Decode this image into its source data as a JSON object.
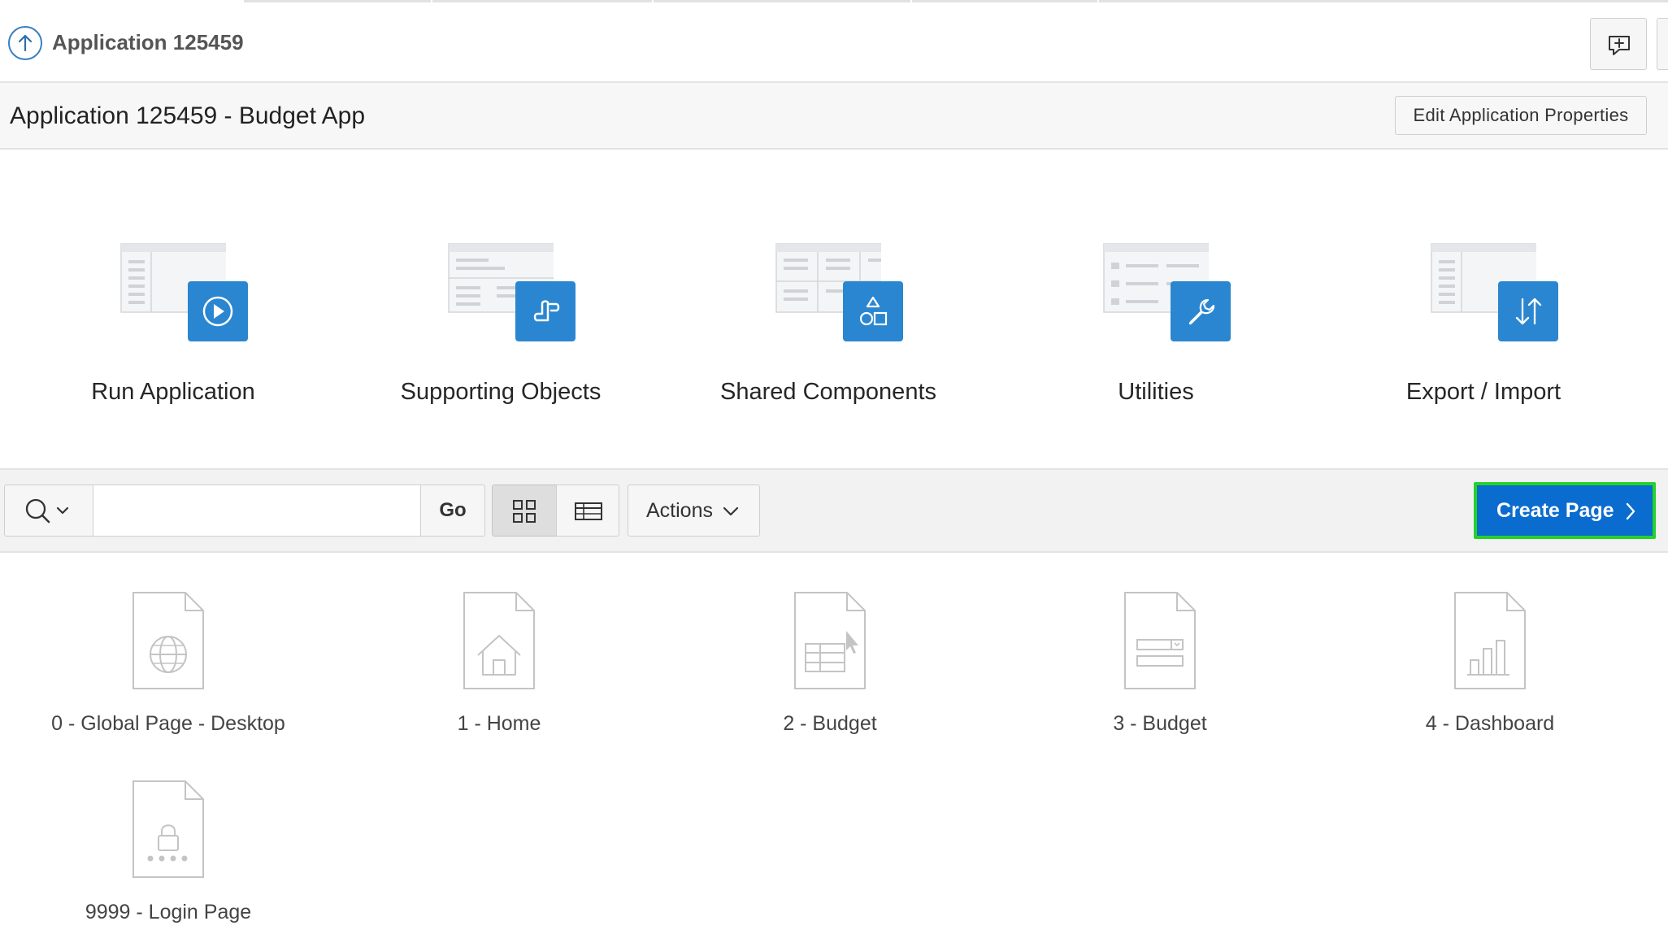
{
  "header": {
    "app_crumb": "Application 125459",
    "feedback_icon": "chat-plus-icon"
  },
  "title_bar": {
    "title": "Application 125459 - Budget App",
    "edit_button": "Edit Application Properties"
  },
  "cards": [
    {
      "label": "Run Application",
      "icon": "play-icon"
    },
    {
      "label": "Supporting Objects",
      "icon": "scroll-icon"
    },
    {
      "label": "Shared Components",
      "icon": "shapes-icon"
    },
    {
      "label": "Utilities",
      "icon": "wrench-icon"
    },
    {
      "label": "Export / Import",
      "icon": "arrows-updown-icon"
    }
  ],
  "toolbar": {
    "search_placeholder": "",
    "go_label": "Go",
    "actions_label": "Actions",
    "create_page_label": "Create Page"
  },
  "pages": [
    {
      "label": "0 - Global Page - Desktop",
      "icon": "globe-icon"
    },
    {
      "label": "1 - Home",
      "icon": "house-icon"
    },
    {
      "label": "2 - Budget",
      "icon": "grid-cursor-icon"
    },
    {
      "label": "3 - Budget",
      "icon": "form-icon"
    },
    {
      "label": "4 - Dashboard",
      "icon": "bar-chart-icon"
    },
    {
      "label": "9999 - Login Page",
      "icon": "lock-icon"
    }
  ],
  "colors": {
    "accent": "#2a86d0",
    "create_button": "#0b6cd0",
    "highlight": "#24d22a"
  }
}
